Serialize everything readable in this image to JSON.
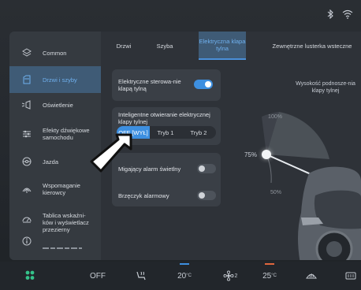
{
  "statusbar": {
    "icons": [
      "bluetooth-icon",
      "wifi-icon"
    ]
  },
  "sidebar": {
    "items": [
      {
        "label": "Common",
        "icon": "layers-icon"
      },
      {
        "label": "Drzwi i szyby",
        "icon": "door-icon",
        "active": true
      },
      {
        "label": "Oświetlenie",
        "icon": "light-icon"
      },
      {
        "label": "Efekty dźwiękowe samochodu",
        "icon": "equalizer-icon"
      },
      {
        "label": "Jazda",
        "icon": "steering-wheel-icon"
      },
      {
        "label": "Wspomaganie kierowcy",
        "icon": "driver-assist-icon"
      },
      {
        "label": "Tablica wskaźni-ków i wyświetlacz przezierny",
        "icon": "dashboard-icon"
      },
      {
        "label": "",
        "icon": "info-icon"
      }
    ]
  },
  "tabs": [
    {
      "label": "Drzwi"
    },
    {
      "label": "Szyba"
    },
    {
      "label": "Elektryczna klapa tylna",
      "active": true
    },
    {
      "label": "Zewnętrzne lusterka wsteczne"
    }
  ],
  "settings": {
    "electric_control": {
      "label": "Elektryczne sterowa-nie klapą tylną",
      "on": true
    },
    "smart_open": {
      "label": "Inteligentne otwieranie elektrycznej klapy tylnej",
      "options": [
        "OFF [WYŁ]",
        "Tryb 1",
        "Tryb 2"
      ],
      "selected": "OFF [WYŁ]"
    },
    "flash_alarm": {
      "label": "Migający alarm świetlny",
      "on": false
    },
    "buzzer_alarm": {
      "label": "Brzęczyk alarmowy",
      "on": false
    }
  },
  "tailgate": {
    "title": "Wysokość podnosze-nia klapy tylnej",
    "current": "75%",
    "max_label": "100%",
    "min_label": "50%"
  },
  "bottombar": {
    "menu_icon": "app-grid-icon",
    "ac_label": "OFF",
    "seat_icon": "seat-heat-icon",
    "temp_left": "20",
    "temp_left_unit": "°C",
    "fan_level": "2",
    "fan_icon": "fan-icon",
    "temp_right": "25",
    "temp_right_unit": "°C",
    "defrost_front_icon": "defrost-front-icon",
    "defrost_rear_icon": "defrost-rear-icon"
  },
  "colors": {
    "accent": "#3d8fe0",
    "active_text": "#6fb0ee",
    "active_bg": "#3f5b76",
    "temp_left_bar": "#3d8fe0",
    "temp_right_bar": "#e0663d"
  }
}
